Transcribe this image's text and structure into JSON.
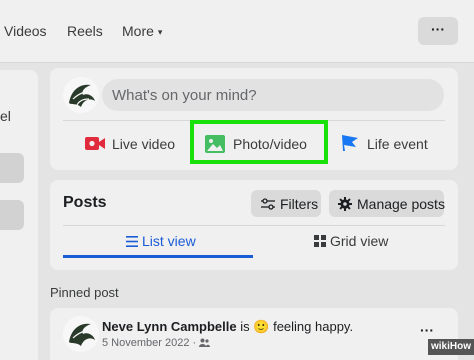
{
  "nav": {
    "items": [
      "Videos",
      "Reels",
      "More"
    ],
    "more_caret": "▾",
    "dots": "···"
  },
  "left_panel": {
    "partial_text": "el"
  },
  "composer": {
    "placeholder": "What's on your mind?",
    "actions": {
      "live_video": "Live video",
      "photo_video": "Photo/video",
      "life_event": "Life event"
    },
    "highlight_color": "#19e10c"
  },
  "posts": {
    "title": "Posts",
    "filters_label": "Filters",
    "manage_label": "Manage posts",
    "tabs": {
      "list_view": "List view",
      "grid_view": "Grid view"
    },
    "active_tab": "list_view",
    "accent_color": "#1a5bd6"
  },
  "pinned": {
    "section_label": "Pinned post",
    "author_name": "Neve Lynn Campbelle",
    "status_prefix": "is",
    "emoji": "🙂",
    "status_text": "feeling happy.",
    "date": "5 November 2022 ·",
    "audience_icon": "friends-icon",
    "dots": "···"
  },
  "watermark": {
    "text": "wikiHow"
  },
  "icons": {
    "live_video": "live-video-icon",
    "photo_video": "photo-icon",
    "life_event": "flag-icon",
    "filters": "sliders-icon",
    "manage": "gear-icon",
    "list_view": "list-icon",
    "grid_view": "grid-icon"
  },
  "colors": {
    "live_red": "#e02b3c",
    "photo_green": "#45bd62",
    "flag_blue": "#1877f2"
  }
}
